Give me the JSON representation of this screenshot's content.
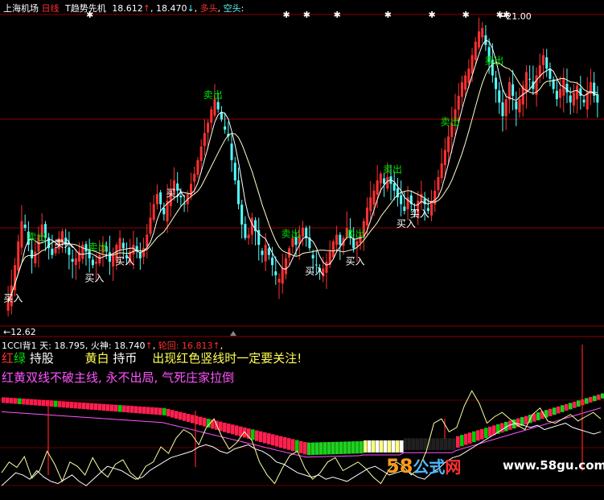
{
  "header": {
    "stock": "上海机场",
    "period": "日线",
    "indicator": "T趋势先机",
    "value1": "18.612",
    "value2": "18.470",
    "bull": "多头",
    "bear": "空头"
  },
  "sub_header": {
    "name": "1CCI背1",
    "tian_label": "天",
    "tian_value": "18.795",
    "huoshen_label": "火神",
    "huoshen_value": "18.740",
    "lunhui_label": "轮回",
    "lunhui_value": "16.813"
  },
  "notes": {
    "hong": "红",
    "lv": "绿",
    "chigu": "持股",
    "huangbai": "黄白",
    "chibi": "持币",
    "warn": "出现红色竖线时一定要关注!",
    "line2": "红黄双线不破主线, 永不出局, 气死庄家拉倒"
  },
  "watermark": {
    "digits": "58",
    "word1": "公式",
    "word2": "网",
    "url": "www.58gu.com"
  },
  "colors": {
    "up": "#ff3030",
    "down": "#54fcfc",
    "white": "#ffffff",
    "yellow": "#ffff54",
    "green": "#00e000",
    "magenta": "#ff54ff",
    "divider": "#8b0000"
  },
  "chart_data": [
    {
      "type": "candlestick",
      "price_labels": {
        "high": "21.00",
        "low": "12.62"
      },
      "ylim": [
        12.2,
        21.4
      ],
      "close": [
        12.9,
        13.4,
        14.0,
        14.7,
        15.3,
        15.1,
        14.6,
        14.2,
        14.4,
        14.9,
        15.2,
        14.8,
        14.5,
        14.3,
        14.5,
        14.8,
        15.0,
        14.6,
        14.3,
        14.1,
        14.2,
        14.4,
        14.6,
        14.4,
        14.2,
        14.0,
        14.1,
        14.3,
        14.6,
        14.4,
        14.1,
        14.3,
        14.6,
        14.8,
        14.5,
        14.2,
        14.4,
        14.6,
        14.4,
        14.2,
        14.5,
        14.9,
        15.4,
        15.8,
        16.1,
        15.8,
        15.5,
        15.9,
        16.2,
        16.5,
        16.2,
        16.0,
        15.8,
        16.1,
        16.4,
        16.7,
        17.1,
        17.5,
        17.9,
        18.2,
        18.6,
        18.9,
        18.6,
        18.3,
        18.0,
        17.8,
        17.1,
        16.5,
        15.8,
        15.2,
        14.8,
        14.9,
        15.4,
        15.0,
        14.6,
        14.3,
        14.6,
        14.3,
        14.0,
        13.7,
        13.6,
        13.9,
        14.2,
        14.5,
        14.8,
        14.6,
        14.9,
        15.1,
        14.8,
        14.5,
        14.2,
        14.0,
        13.8,
        13.9,
        14.1,
        14.4,
        14.7,
        14.9,
        14.6,
        14.8,
        15.1,
        14.8,
        14.5,
        14.7,
        14.9,
        15.3,
        15.7,
        16.0,
        16.2,
        16.5,
        16.7,
        16.4,
        16.6,
        16.4,
        16.2,
        16.0,
        15.8,
        15.6,
        16.0,
        15.8,
        15.6,
        15.9,
        16.1,
        15.8,
        15.6,
        15.9,
        16.2,
        16.6,
        17.0,
        17.4,
        17.8,
        18.2,
        18.6,
        19.0,
        19.4,
        19.6,
        19.8,
        20.2,
        20.6,
        20.9,
        21.0,
        20.5,
        20.0,
        19.6,
        19.2,
        18.8,
        18.4,
        18.9,
        19.4,
        19.0,
        18.6,
        18.9,
        19.3,
        19.7,
        19.5,
        19.2,
        19.6,
        19.9,
        20.2,
        19.8,
        19.5,
        19.2,
        18.9,
        19.2,
        19.5,
        19.1,
        18.8,
        19.1,
        19.3,
        19.0,
        18.8,
        19.1,
        19.4,
        19.0,
        18.8
      ],
      "series": [
        {
          "name": "short",
          "window": 5
        },
        {
          "name": "long",
          "window": 12
        }
      ],
      "markers": {
        "sell_label": "卖出",
        "buy_label": "买入",
        "sell_bars": [
          8,
          26,
          60,
          83,
          102,
          113,
          130,
          143
        ],
        "buy_bars": [
          1,
          16,
          25,
          34,
          49,
          90,
          102,
          117,
          121
        ],
        "cross_bars": [
          24,
          82,
          88,
          97,
          112,
          125,
          135,
          145,
          147
        ]
      }
    },
    {
      "type": "line",
      "ylim": [
        0,
        100
      ],
      "x": [
        0,
        149
      ],
      "series": [
        {
          "name": "white",
          "values": [
            8,
            14,
            20,
            18,
            14,
            22,
            16,
            12,
            10,
            14,
            18,
            12,
            8,
            14,
            20,
            26,
            24,
            22,
            18,
            14,
            16,
            22,
            26,
            30,
            34,
            36,
            38,
            40,
            44,
            46,
            44,
            40,
            38,
            42,
            44,
            46,
            42,
            40,
            36,
            30,
            28,
            24,
            20,
            18,
            16,
            18,
            14,
            16,
            14,
            12,
            16,
            20,
            24,
            26,
            22,
            18,
            20,
            22,
            20,
            16,
            14,
            20,
            24,
            30,
            34,
            36,
            40,
            44,
            48,
            52,
            56,
            60,
            64,
            66,
            64,
            62,
            64,
            60,
            62,
            64,
            66,
            62,
            60,
            58,
            56,
            58
          ]
        },
        {
          "name": "yellow",
          "values": [
            20,
            30,
            25,
            35,
            15,
            22,
            40,
            28,
            12,
            30,
            26,
            18,
            34,
            22,
            16,
            28,
            32,
            20,
            14,
            26,
            30,
            44,
            38,
            52,
            60,
            56,
            46,
            62,
            70,
            54,
            42,
            48,
            58,
            50,
            30,
            18,
            10,
            24,
            36,
            40,
            24,
            14,
            20,
            30,
            34,
            22,
            26,
            30,
            24,
            16,
            10,
            22,
            30,
            26,
            18,
            24,
            40,
            66,
            70,
            58,
            62,
            82,
            96,
            84,
            66,
            72,
            76,
            70,
            64,
            60,
            74,
            80,
            68,
            66,
            70,
            74,
            68,
            72,
            76,
            70
          ]
        }
      ],
      "bars": {
        "type": "bar",
        "name": "band",
        "ylim": [
          0,
          100
        ]
      }
    }
  ]
}
